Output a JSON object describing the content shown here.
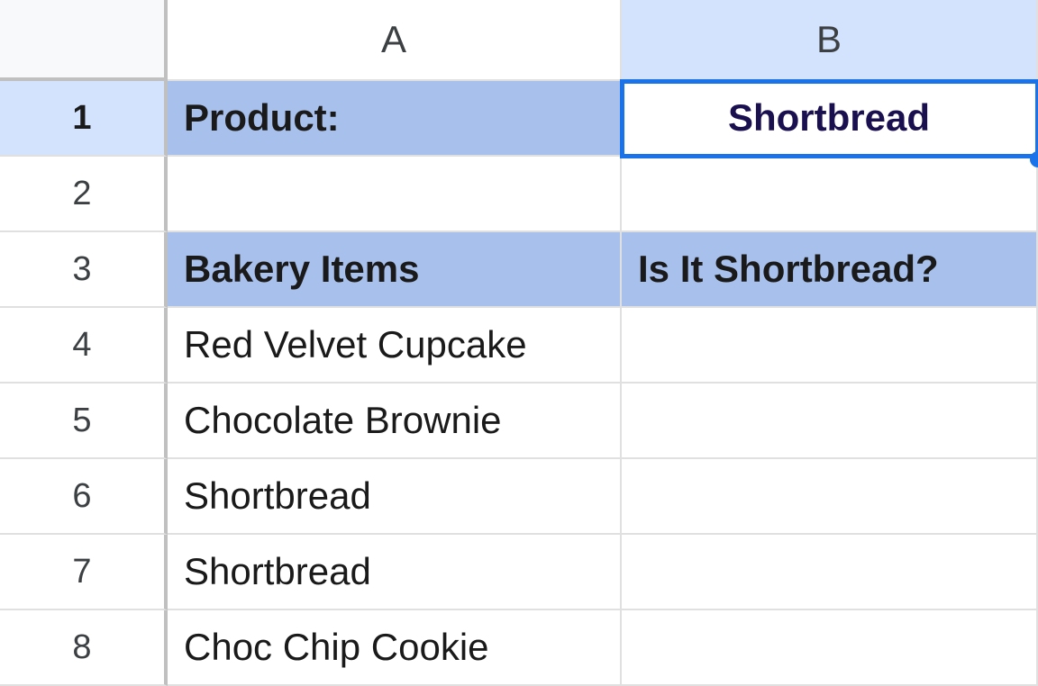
{
  "columns": [
    "A",
    "B"
  ],
  "row_numbers": [
    "1",
    "2",
    "3",
    "4",
    "5",
    "6",
    "7",
    "8"
  ],
  "highlighted_row": 1,
  "highlighted_col": "B",
  "selected_cell": {
    "row": 1,
    "col": "B"
  },
  "cells": {
    "A1": {
      "value": "Product:",
      "style": "header"
    },
    "B1": {
      "value": "Shortbread",
      "style": "selected"
    },
    "A2": {
      "value": "",
      "style": "normal"
    },
    "B2": {
      "value": "",
      "style": "normal"
    },
    "A3": {
      "value": "Bakery Items",
      "style": "header"
    },
    "B3": {
      "value": "Is It Shortbread?",
      "style": "header"
    },
    "A4": {
      "value": "Red Velvet Cupcake",
      "style": "normal"
    },
    "B4": {
      "value": "",
      "style": "normal"
    },
    "A5": {
      "value": "Chocolate Brownie",
      "style": "normal"
    },
    "B5": {
      "value": "",
      "style": "normal"
    },
    "A6": {
      "value": "Shortbread",
      "style": "normal"
    },
    "B6": {
      "value": "",
      "style": "normal"
    },
    "A7": {
      "value": "Shortbread",
      "style": "normal"
    },
    "B7": {
      "value": "",
      "style": "normal"
    },
    "A8": {
      "value": "Choc Chip Cookie",
      "style": "normal"
    },
    "B8": {
      "value": "",
      "style": "normal"
    }
  }
}
